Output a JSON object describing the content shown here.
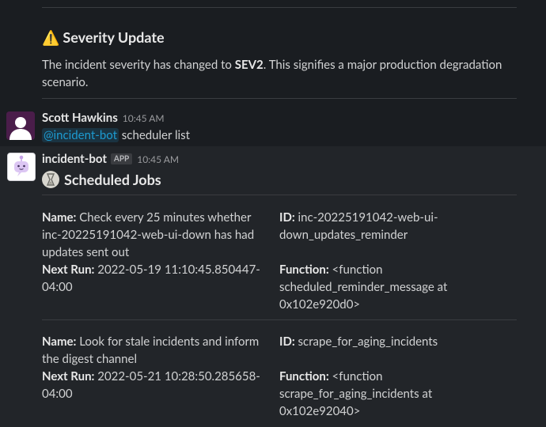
{
  "severity": {
    "emoji": "⚠️",
    "title": "Severity Update",
    "text_before": "The incident severity has changed to ",
    "severity_value": "SEV2",
    "text_after": ". This signifies a major production degradation scenario."
  },
  "messages": [
    {
      "user": "Scott Hawkins",
      "time": "10:45 AM",
      "mention": "@incident-bot",
      "text": " scheduler list"
    },
    {
      "user": "incident-bot",
      "badge": "APP",
      "time": "10:45 AM",
      "heading_icon": "hourglass-icon",
      "heading": "Scheduled Jobs"
    }
  ],
  "jobs": [
    {
      "name_label": "Name:",
      "name": " Check every 25 minutes whether inc-20225191042-web-ui-down has had updates sent out",
      "next_run_label": "Next Run:",
      "next_run": " 2022-05-19 11:10:45.850447-04:00",
      "id_label": "ID:",
      "id": " inc-20225191042-web-ui-down_updates_reminder",
      "function_label": "Function:",
      "function": " <function scheduled_reminder_message at 0x102e920d0>"
    },
    {
      "name_label": "Name:",
      "name": " Look for stale incidents and inform the digest channel",
      "next_run_label": "Next Run:",
      "next_run": " 2022-05-21 10:28:50.285658-04:00",
      "id_label": "ID:",
      "id": " scrape_for_aging_incidents",
      "function_label": "Function:",
      "function": " <function scrape_for_aging_incidents at 0x102e92040>"
    }
  ],
  "colors": {
    "background": "#1a1d21",
    "bot_background": "#222529",
    "mention": "#1d9bd1",
    "avatar_user": "#4a1d4a"
  }
}
